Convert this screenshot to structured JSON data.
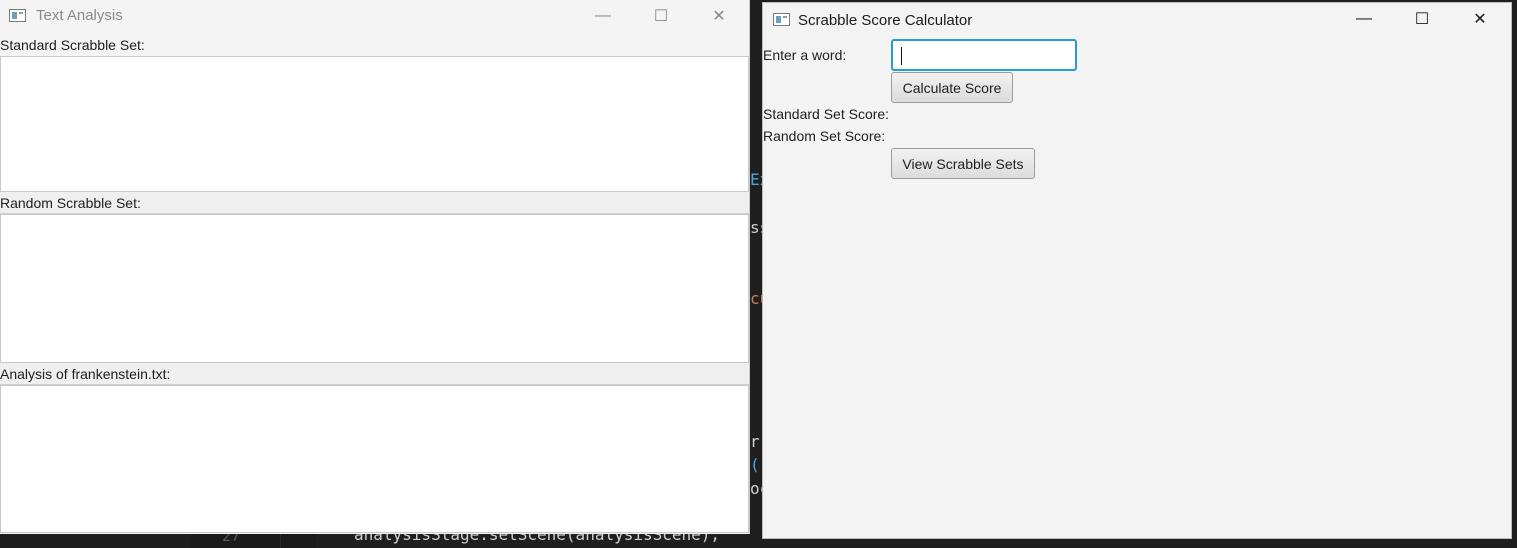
{
  "background_code": {
    "line_number": "27",
    "line_text": "analysisStage.setScene(analysisScene);",
    "fragments": [
      "Ex",
      "ss",
      "cu",
      "r",
      "()",
      "oc"
    ]
  },
  "text_analysis_window": {
    "title": "Text Analysis",
    "controls": {
      "minimize": "—",
      "maximize": "☐",
      "close": "✕"
    },
    "sections": [
      {
        "label": "Standard Scrabble Set:",
        "content": ""
      },
      {
        "label": "Random Scrabble Set:",
        "content": ""
      },
      {
        "label": "Analysis of frankenstein.txt:",
        "content": ""
      }
    ]
  },
  "scrabble_window": {
    "title": "Scrabble Score Calculator",
    "controls": {
      "minimize": "—",
      "maximize": "☐",
      "close": "✕"
    },
    "word_label": "Enter a word:",
    "word_value": "",
    "calculate_label": "Calculate Score",
    "standard_score_label": "Standard Set Score:",
    "random_score_label": "Random Set Score:",
    "view_sets_label": "View Scrabble Sets"
  },
  "colors": {
    "focus_accent": "#2a9ad2",
    "code_keyword": "#4fa3e0",
    "code_orange": "#c9835a"
  }
}
